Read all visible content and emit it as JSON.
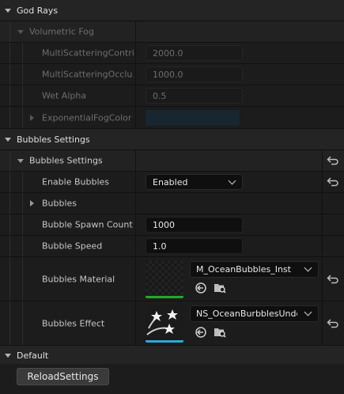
{
  "categories": {
    "god_rays": "God Rays",
    "bubbles_settings": "Bubbles Settings",
    "default": "Default"
  },
  "volumetric_fog": {
    "group_label": "Volumetric Fog",
    "rows": [
      {
        "label": "MultiScatteringContri...",
        "value": "2000.0"
      },
      {
        "label": "MultiScatteringOcclu...",
        "value": "1000.0"
      },
      {
        "label": "Wet Alpha",
        "value": "0.5"
      }
    ],
    "exponential_fog_color_label": "ExponentialFogColor",
    "exponential_fog_color": "#14303f"
  },
  "bubbles": {
    "group_label": "Bubbles Settings",
    "enable_label": "Enable Bubbles",
    "enable_value": "Enabled",
    "bubbles_label": "Bubbles",
    "spawn_count_label": "Bubble Spawn Count",
    "spawn_count_value": "1000",
    "speed_label": "Bubble Speed",
    "speed_value": "1.0",
    "material_label": "Bubbles Material",
    "material_value": "M_OceanBubbles_Inst",
    "effect_label": "Bubbles Effect",
    "effect_value": "NS_OceanBurbblesUnderv"
  },
  "default": {
    "reload_button": "ReloadSettings"
  },
  "icons": {
    "expand": "triangle-down-icon",
    "collapse": "triangle-right-icon",
    "reset": "reset-arrow-icon",
    "browse": "browse-arrow-icon",
    "find": "folder-search-icon",
    "stars": "stars-icon"
  },
  "colors": {
    "material_bar": "#1faa2a",
    "effect_bar": "#2ea8d8"
  }
}
